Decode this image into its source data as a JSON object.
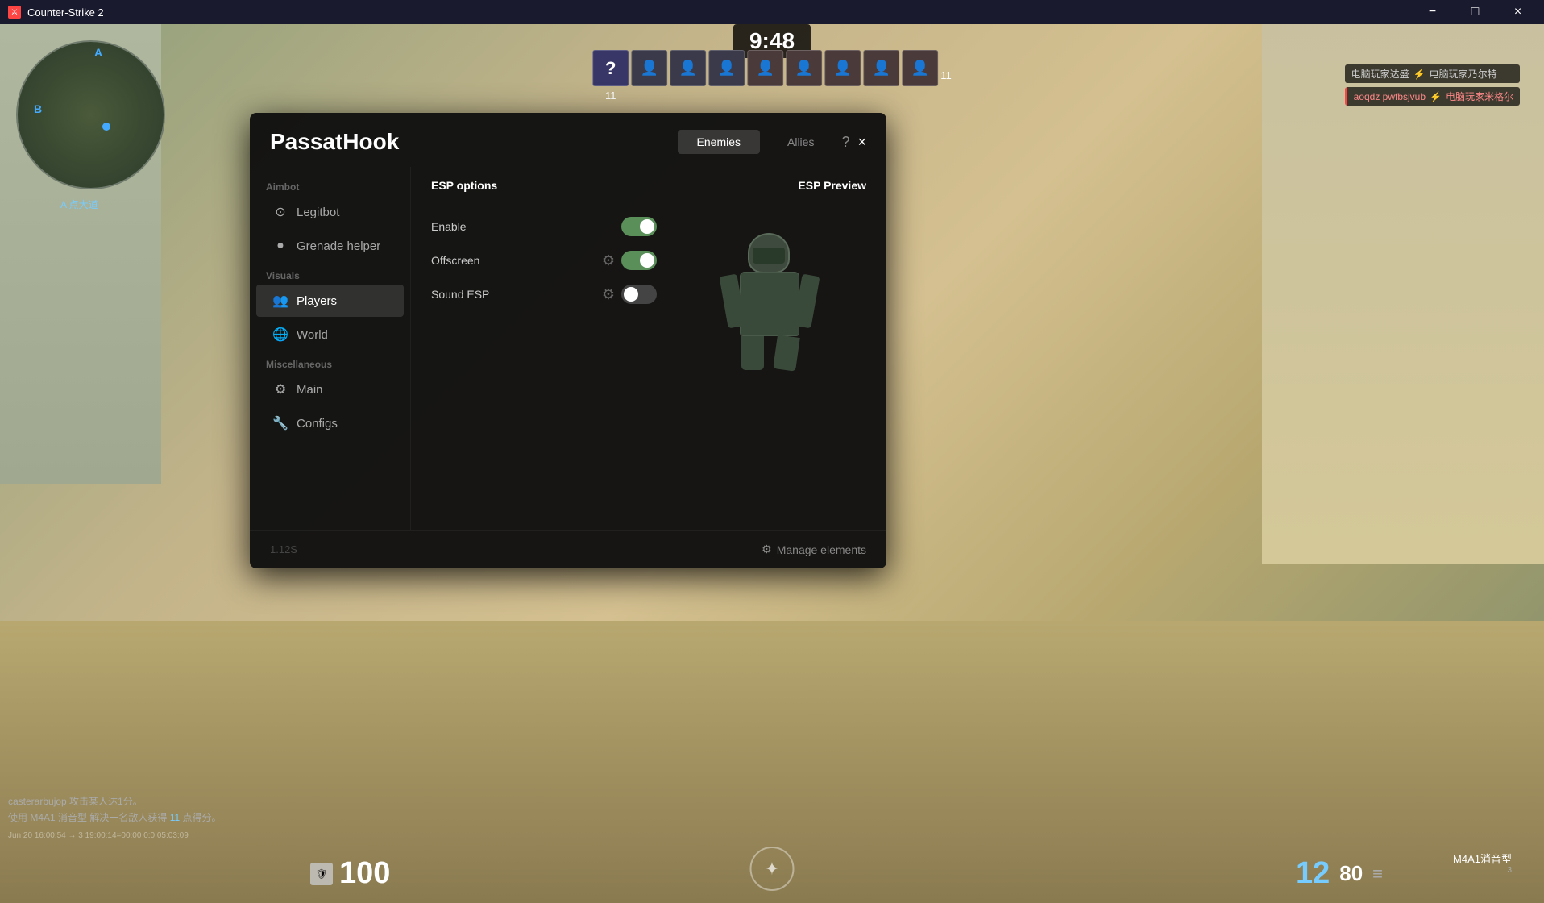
{
  "window": {
    "title": "Counter-Strike 2",
    "titlebar_icon": "⚔"
  },
  "titlebar_controls": {
    "minimize": "−",
    "maximize": "□",
    "close": "×"
  },
  "hud": {
    "timer": "9:48",
    "health": "100",
    "kills": "12",
    "ammo": "80",
    "weapon": "M4A1消音型",
    "armor_value": "100",
    "label_a": "A",
    "label_b": "B",
    "location": "A 点大道",
    "ammo_icon": "≡"
  },
  "player_avatars": {
    "question_mark": "?",
    "team1_count": "11",
    "team2_count": "11"
  },
  "killfeed": [
    {
      "text": "电脑玩家达盛 ——— 电脑玩家乃尔特"
    },
    {
      "text": "aoqdz pwfbsjvub ——— 电脑玩家米格尔",
      "red": true
    }
  ],
  "chat": [
    {
      "text": "casterarbujop 攻击某人达1分。",
      "has_link": false
    },
    {
      "text": "使用 M4A1 消音型 解决一名敌人获得 11 点得分。",
      "highlight": "11",
      "green_word": "11"
    }
  ],
  "timestamp": "Jun 20 16:00:54 → 3 19:00:14=00:00 0:0 05:03:09",
  "cheat": {
    "title": "PassatHook",
    "tabs": [
      {
        "label": "Enemies",
        "active": true
      },
      {
        "label": "Allies",
        "active": false
      }
    ],
    "help_btn": "?",
    "close_btn": "×",
    "sidebar": {
      "sections": [
        {
          "label": "Aimbot",
          "items": [
            {
              "id": "legitbot",
              "label": "Legitbot",
              "icon": "⊙"
            },
            {
              "id": "grenade-helper",
              "label": "Grenade helper",
              "icon": "●"
            }
          ]
        },
        {
          "label": "Visuals",
          "items": [
            {
              "id": "players",
              "label": "Players",
              "icon": "👥",
              "active": true
            },
            {
              "id": "world",
              "label": "World",
              "icon": "🌐"
            }
          ]
        },
        {
          "label": "Miscellaneous",
          "items": [
            {
              "id": "main",
              "label": "Main",
              "icon": "⚙"
            },
            {
              "id": "configs",
              "label": "Configs",
              "icon": "🔧"
            }
          ]
        }
      ]
    },
    "esp": {
      "options_title": "ESP options",
      "preview_title": "ESP Preview",
      "options": [
        {
          "id": "enable",
          "label": "Enable",
          "on": true,
          "has_gear": false
        },
        {
          "id": "offscreen",
          "label": "Offscreen",
          "on": true,
          "has_gear": true
        },
        {
          "id": "sound-esp",
          "label": "Sound ESP",
          "on": false,
          "has_gear": true
        }
      ]
    },
    "footer": {
      "version": "1.12S",
      "manage_elements": "Manage elements",
      "gear_icon": "⚙"
    }
  }
}
